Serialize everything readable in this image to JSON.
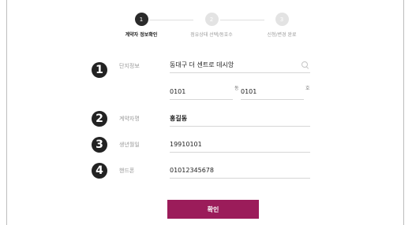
{
  "stepper": {
    "steps": [
      {
        "number": "1",
        "label": "계약자 정보확인"
      },
      {
        "number": "2",
        "label": "점유상태 선택/동호수"
      },
      {
        "number": "3",
        "label": "신청/변경 완료"
      }
    ]
  },
  "form": {
    "complex": {
      "badge": "1",
      "label": "단지정보",
      "value": "동대구 더 센트로 데시앙"
    },
    "unit": {
      "dong_value": "0101",
      "dong_suffix": "동",
      "ho_value": "0101",
      "ho_suffix": "호"
    },
    "contractor": {
      "badge": "2",
      "label": "계약자명",
      "value": "홍길동"
    },
    "birth": {
      "badge": "3",
      "label": "생년월일",
      "value": "19910101"
    },
    "phone": {
      "badge": "4",
      "label": "핸드폰",
      "value": "01012345678"
    }
  },
  "actions": {
    "confirm_label": "확인"
  },
  "colors": {
    "accent": "#9b1c5a",
    "active_step": "#2b2b2b",
    "inactive_step": "#e3e3e3"
  }
}
